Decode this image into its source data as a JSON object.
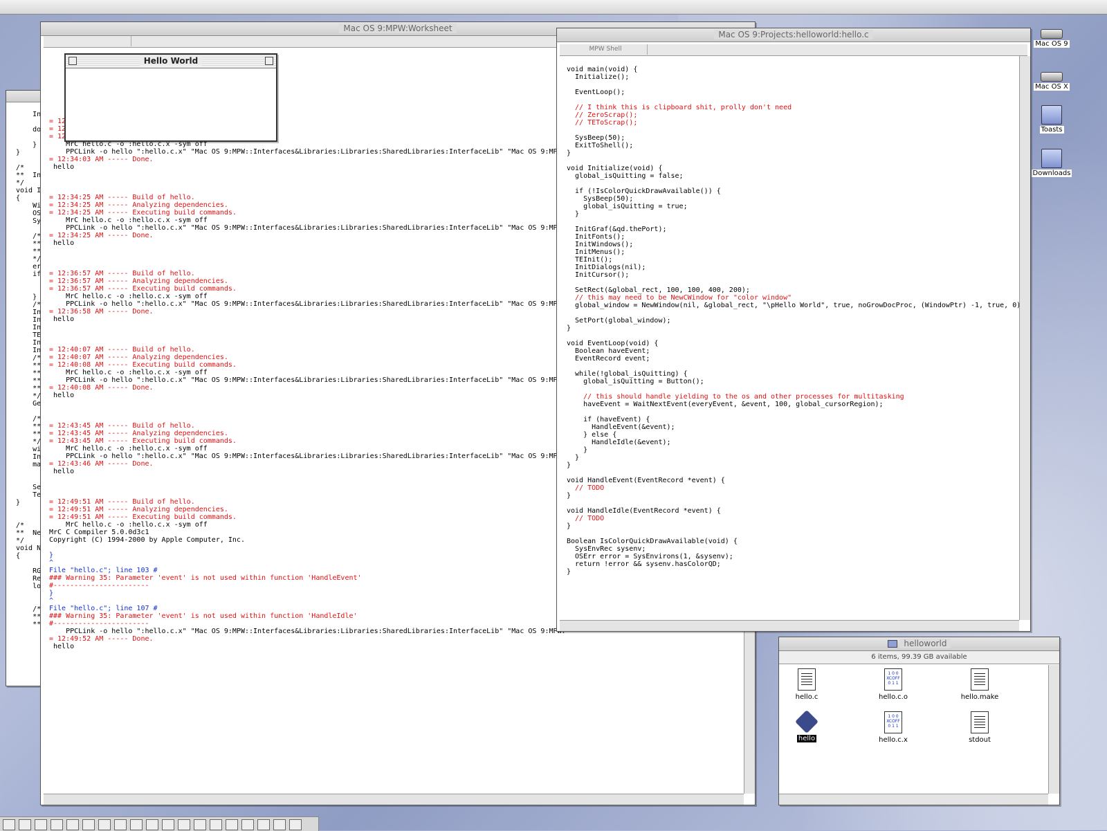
{
  "desktop": {
    "icons": [
      {
        "name": "mac-os-9-drive",
        "label": "Mac OS 9",
        "kind": "drive"
      },
      {
        "name": "mac-os-x-drive",
        "label": "Mac OS X",
        "kind": "drive"
      },
      {
        "name": "toasts-folder",
        "label": "Toasts",
        "kind": "folder"
      },
      {
        "name": "downloads-folder",
        "label": "Downloads",
        "kind": "folder"
      }
    ]
  },
  "worksheet": {
    "title": "Mac OS 9:MPW:Worksheet",
    "lines": [
      {
        "t": "= 12",
        "c": "red"
      },
      {
        "t": "= 12",
        "c": "red"
      },
      {
        "t": "= 12",
        "c": "red"
      },
      {
        "t": "    MrC hello.c -o :hello.c.x -sym off",
        "c": "mix"
      },
      {
        "t": "    PPCLink -o hello \":hello.c.x\" \"Mac OS 9:MPW::Interfaces&Libraries:Libraries:SharedLibraries:InterfaceLib\" \"Mac OS 9:MPW:",
        "c": "mix"
      },
      {
        "t": "= 12:34:03 AM ----- Done.",
        "c": "red"
      },
      {
        "t": " hello",
        "c": ""
      },
      {
        "t": "",
        "c": ""
      },
      {
        "t": "",
        "c": ""
      },
      {
        "t": "",
        "c": ""
      },
      {
        "t": "= 12:34:25 AM ----- Build of hello.",
        "c": "red"
      },
      {
        "t": "= 12:34:25 AM ----- Analyzing dependencies.",
        "c": "red"
      },
      {
        "t": "= 12:34:25 AM ----- Executing build commands.",
        "c": "red"
      },
      {
        "t": "    MrC hello.c -o :hello.c.x -sym off",
        "c": "mix"
      },
      {
        "t": "    PPCLink -o hello \":hello.c.x\" \"Mac OS 9:MPW::Interfaces&Libraries:Libraries:SharedLibraries:InterfaceLib\" \"Mac OS 9:MPW:",
        "c": "mix"
      },
      {
        "t": "= 12:34:25 AM ----- Done.",
        "c": "red"
      },
      {
        "t": " hello",
        "c": ""
      },
      {
        "t": "",
        "c": ""
      },
      {
        "t": "",
        "c": ""
      },
      {
        "t": "",
        "c": ""
      },
      {
        "t": "= 12:36:57 AM ----- Build of hello.",
        "c": "red"
      },
      {
        "t": "= 12:36:57 AM ----- Analyzing dependencies.",
        "c": "red"
      },
      {
        "t": "= 12:36:57 AM ----- Executing build commands.",
        "c": "red"
      },
      {
        "t": "    MrC hello.c -o :hello.c.x -sym off",
        "c": "mix"
      },
      {
        "t": "    PPCLink -o hello \":hello.c.x\" \"Mac OS 9:MPW::Interfaces&Libraries:Libraries:SharedLibraries:InterfaceLib\" \"Mac OS 9:MPW:",
        "c": "mix"
      },
      {
        "t": "= 12:36:58 AM ----- Done.",
        "c": "red"
      },
      {
        "t": " hello",
        "c": ""
      },
      {
        "t": "",
        "c": ""
      },
      {
        "t": "",
        "c": ""
      },
      {
        "t": "",
        "c": ""
      },
      {
        "t": "= 12:40:07 AM ----- Build of hello.",
        "c": "red"
      },
      {
        "t": "= 12:40:07 AM ----- Analyzing dependencies.",
        "c": "red"
      },
      {
        "t": "= 12:40:08 AM ----- Executing build commands.",
        "c": "red"
      },
      {
        "t": "    MrC hello.c -o :hello.c.x -sym off",
        "c": "mix"
      },
      {
        "t": "    PPCLink -o hello \":hello.c.x\" \"Mac OS 9:MPW::Interfaces&Libraries:Libraries:SharedLibraries:InterfaceLib\" \"Mac OS 9:MPW:",
        "c": "mix"
      },
      {
        "t": "= 12:40:08 AM ----- Done.",
        "c": "red"
      },
      {
        "t": " hello",
        "c": ""
      },
      {
        "t": "",
        "c": ""
      },
      {
        "t": "",
        "c": ""
      },
      {
        "t": "",
        "c": ""
      },
      {
        "t": "= 12:43:45 AM ----- Build of hello.",
        "c": "red"
      },
      {
        "t": "= 12:43:45 AM ----- Analyzing dependencies.",
        "c": "red"
      },
      {
        "t": "= 12:43:45 AM ----- Executing build commands.",
        "c": "red"
      },
      {
        "t": "    MrC hello.c -o :hello.c.x -sym off",
        "c": "mix"
      },
      {
        "t": "    PPCLink -o hello \":hello.c.x\" \"Mac OS 9:MPW::Interfaces&Libraries:Libraries:SharedLibraries:InterfaceLib\" \"Mac OS 9:MPW:",
        "c": "mix"
      },
      {
        "t": "= 12:43:46 AM ----- Done.",
        "c": "red"
      },
      {
        "t": " hello",
        "c": ""
      },
      {
        "t": "",
        "c": ""
      },
      {
        "t": "",
        "c": ""
      },
      {
        "t": "",
        "c": ""
      },
      {
        "t": "= 12:49:51 AM ----- Build of hello.",
        "c": "red"
      },
      {
        "t": "= 12:49:51 AM ----- Analyzing dependencies.",
        "c": "red"
      },
      {
        "t": "= 12:49:51 AM ----- Executing build commands.",
        "c": "red"
      },
      {
        "t": "    MrC hello.c -o :hello.c.x -sym off",
        "c": "mix"
      },
      {
        "t": "MrC C Compiler 5.0.0d3c1",
        "c": "mix"
      },
      {
        "t": "Copyright (C) 1994-2000 by Apple Computer, Inc.",
        "c": ""
      },
      {
        "t": "",
        "c": ""
      },
      {
        "t": "}",
        "c": "blue"
      },
      {
        "t": "^",
        "c": "blue"
      },
      {
        "t": "File \"hello.c\"; line 103 #",
        "c": "blue"
      },
      {
        "t": "### Warning 35: Parameter 'event' is not used within function 'HandleEvent'",
        "c": "red"
      },
      {
        "t": "#-----------------------",
        "c": "red"
      },
      {
        "t": "}",
        "c": "blue"
      },
      {
        "t": "^",
        "c": "blue"
      },
      {
        "t": "File \"hello.c\"; line 107 #",
        "c": "blue"
      },
      {
        "t": "### Warning 35: Parameter 'event' is not used within function 'HandleIdle'",
        "c": "red"
      },
      {
        "t": "#-----------------------",
        "c": "red"
      },
      {
        "t": "    PPCLink -o hello \":hello.c.x\" \"Mac OS 9:MPW::Interfaces&Libraries:Libraries:SharedLibraries:InterfaceLib\" \"Mac OS 9:MPW:",
        "c": "mix"
      },
      {
        "t": "= 12:49:52 AM ----- Done.",
        "c": "red"
      },
      {
        "t": " hello",
        "c": ""
      }
    ]
  },
  "back_window": {
    "lines": [
      "    In",
      "",
      "    do",
      "",
      "    }",
      "}",
      "",
      "/*",
      "**  In",
      "*/",
      "void I",
      "{",
      "    Wi",
      "    OS",
      "    Sy",
      "",
      "    /*",
      "    **",
      "    **",
      "    */",
      "    er",
      "    if",
      "",
      "",
      "    }",
      "    /*",
      "    In",
      "    In",
      "    In",
      "    TE",
      "    In",
      "    In",
      "    /*",
      "    **",
      "    **",
      "    **",
      "    **",
      "    */",
      "    Ge",
      "",
      "    /*",
      "    **",
      "    **",
      "    */",
      "    wi",
      "    In",
      "    ma",
      "",
      "",
      "    Se",
      "    Te",
      "}",
      "",
      "",
      "/*",
      "**  Ne",
      "*/",
      "void N",
      "{",
      "",
      "    RG",
      "    Re",
      "    lo",
      "",
      "",
      "    /*",
      "    **",
      "    **"
    ]
  },
  "hello_window": {
    "title": "Hello World"
  },
  "editor": {
    "title": "Mac OS 9:Projects:helloworld:hello.c",
    "status_tab": "MPW Shell",
    "lines": [
      {
        "t": "void main(void) {",
        "c": "code"
      },
      {
        "t": "  Initialize();",
        "c": ""
      },
      {
        "t": "",
        "c": ""
      },
      {
        "t": "  EventLoop();",
        "c": ""
      },
      {
        "t": "",
        "c": ""
      },
      {
        "t": "  // I think this is clipboard shit, prolly don't need",
        "c": "red"
      },
      {
        "t": "  // ZeroScrap();",
        "c": "red"
      },
      {
        "t": "  // TEToScrap();",
        "c": "red"
      },
      {
        "t": "",
        "c": ""
      },
      {
        "t": "  SysBeep(50);",
        "c": ""
      },
      {
        "t": "  ExitToShell();",
        "c": ""
      },
      {
        "t": "}",
        "c": ""
      },
      {
        "t": "",
        "c": ""
      },
      {
        "t": "void Initialize(void) {",
        "c": "code"
      },
      {
        "t": "  global_isQuitting = false;",
        "c": "code"
      },
      {
        "t": "",
        "c": ""
      },
      {
        "t": "  if (!IsColorQuickDrawAvailable()) {",
        "c": "code"
      },
      {
        "t": "    SysBeep(50);",
        "c": ""
      },
      {
        "t": "    global_isQuitting = true;",
        "c": "code"
      },
      {
        "t": "  }",
        "c": ""
      },
      {
        "t": "",
        "c": ""
      },
      {
        "t": "  InitGraf(&qd.thePort);",
        "c": ""
      },
      {
        "t": "  InitFonts();",
        "c": ""
      },
      {
        "t": "  InitWindows();",
        "c": ""
      },
      {
        "t": "  InitMenus();",
        "c": ""
      },
      {
        "t": "  TEInit();",
        "c": ""
      },
      {
        "t": "  InitDialogs(nil);",
        "c": ""
      },
      {
        "t": "  InitCursor();",
        "c": ""
      },
      {
        "t": "",
        "c": ""
      },
      {
        "t": "  SetRect(&global_rect, 100, 100, 400, 200);",
        "c": ""
      },
      {
        "t": "  // this may need to be NewCWindow for \"color window\"",
        "c": "red"
      },
      {
        "t": "  global_window = NewWindow(nil, &global_rect, \"\\pHello World\", true, noGrowDocProc, (WindowPtr) -1, true, 0);",
        "c": "code"
      },
      {
        "t": "",
        "c": ""
      },
      {
        "t": "  SetPort(global_window);",
        "c": ""
      },
      {
        "t": "}",
        "c": ""
      },
      {
        "t": "",
        "c": ""
      },
      {
        "t": "void EventLoop(void) {",
        "c": "code"
      },
      {
        "t": "  Boolean haveEvent;",
        "c": ""
      },
      {
        "t": "  EventRecord event;",
        "c": ""
      },
      {
        "t": "",
        "c": ""
      },
      {
        "t": "  while(!global_isQuitting) {",
        "c": "code"
      },
      {
        "t": "    global_isQuitting = Button();",
        "c": ""
      },
      {
        "t": "",
        "c": ""
      },
      {
        "t": "    // this should handle yielding to the os and other processes for multitasking",
        "c": "red"
      },
      {
        "t": "    haveEvent = WaitNextEvent(everyEvent, &event, 100, global_cursorRegion);",
        "c": ""
      },
      {
        "t": "",
        "c": ""
      },
      {
        "t": "    if (haveEvent) {",
        "c": "code"
      },
      {
        "t": "      HandleEvent(&event);",
        "c": ""
      },
      {
        "t": "    } else {",
        "c": "code"
      },
      {
        "t": "      HandleIdle(&event);",
        "c": ""
      },
      {
        "t": "    }",
        "c": ""
      },
      {
        "t": "  }",
        "c": ""
      },
      {
        "t": "}",
        "c": ""
      },
      {
        "t": "",
        "c": ""
      },
      {
        "t": "void HandleEvent(EventRecord *event) {",
        "c": "code"
      },
      {
        "t": "  // TODO",
        "c": "red"
      },
      {
        "t": "}",
        "c": ""
      },
      {
        "t": "",
        "c": ""
      },
      {
        "t": "void HandleIdle(EventRecord *event) {",
        "c": "code"
      },
      {
        "t": "  // TODO",
        "c": "red"
      },
      {
        "t": "}",
        "c": ""
      },
      {
        "t": "",
        "c": ""
      },
      {
        "t": "Boolean IsColorQuickDrawAvailable(void) {",
        "c": "code"
      },
      {
        "t": "  SysEnvRec sysenv;",
        "c": ""
      },
      {
        "t": "  OSErr error = SysEnvirons(1, &sysenv);",
        "c": ""
      },
      {
        "t": "  return !error && sysenv.hasColorQD;",
        "c": "code"
      },
      {
        "t": "}",
        "c": ""
      }
    ]
  },
  "finder": {
    "title": "helloworld",
    "info": "6 items, 99.39 GB available",
    "items": [
      {
        "label": "hello.c",
        "kind": "text"
      },
      {
        "label": "hello.c.o",
        "kind": "xcoff"
      },
      {
        "label": "hello.make",
        "kind": "text"
      },
      {
        "label": "hello",
        "kind": "app"
      },
      {
        "label": "hello.c.x",
        "kind": "xcoff"
      },
      {
        "label": "stdout",
        "kind": "plain"
      }
    ]
  },
  "colors": {
    "comment_red": "#e01010",
    "keyword_blue": "#1030d0",
    "app_icon": "#3a4a8a"
  }
}
